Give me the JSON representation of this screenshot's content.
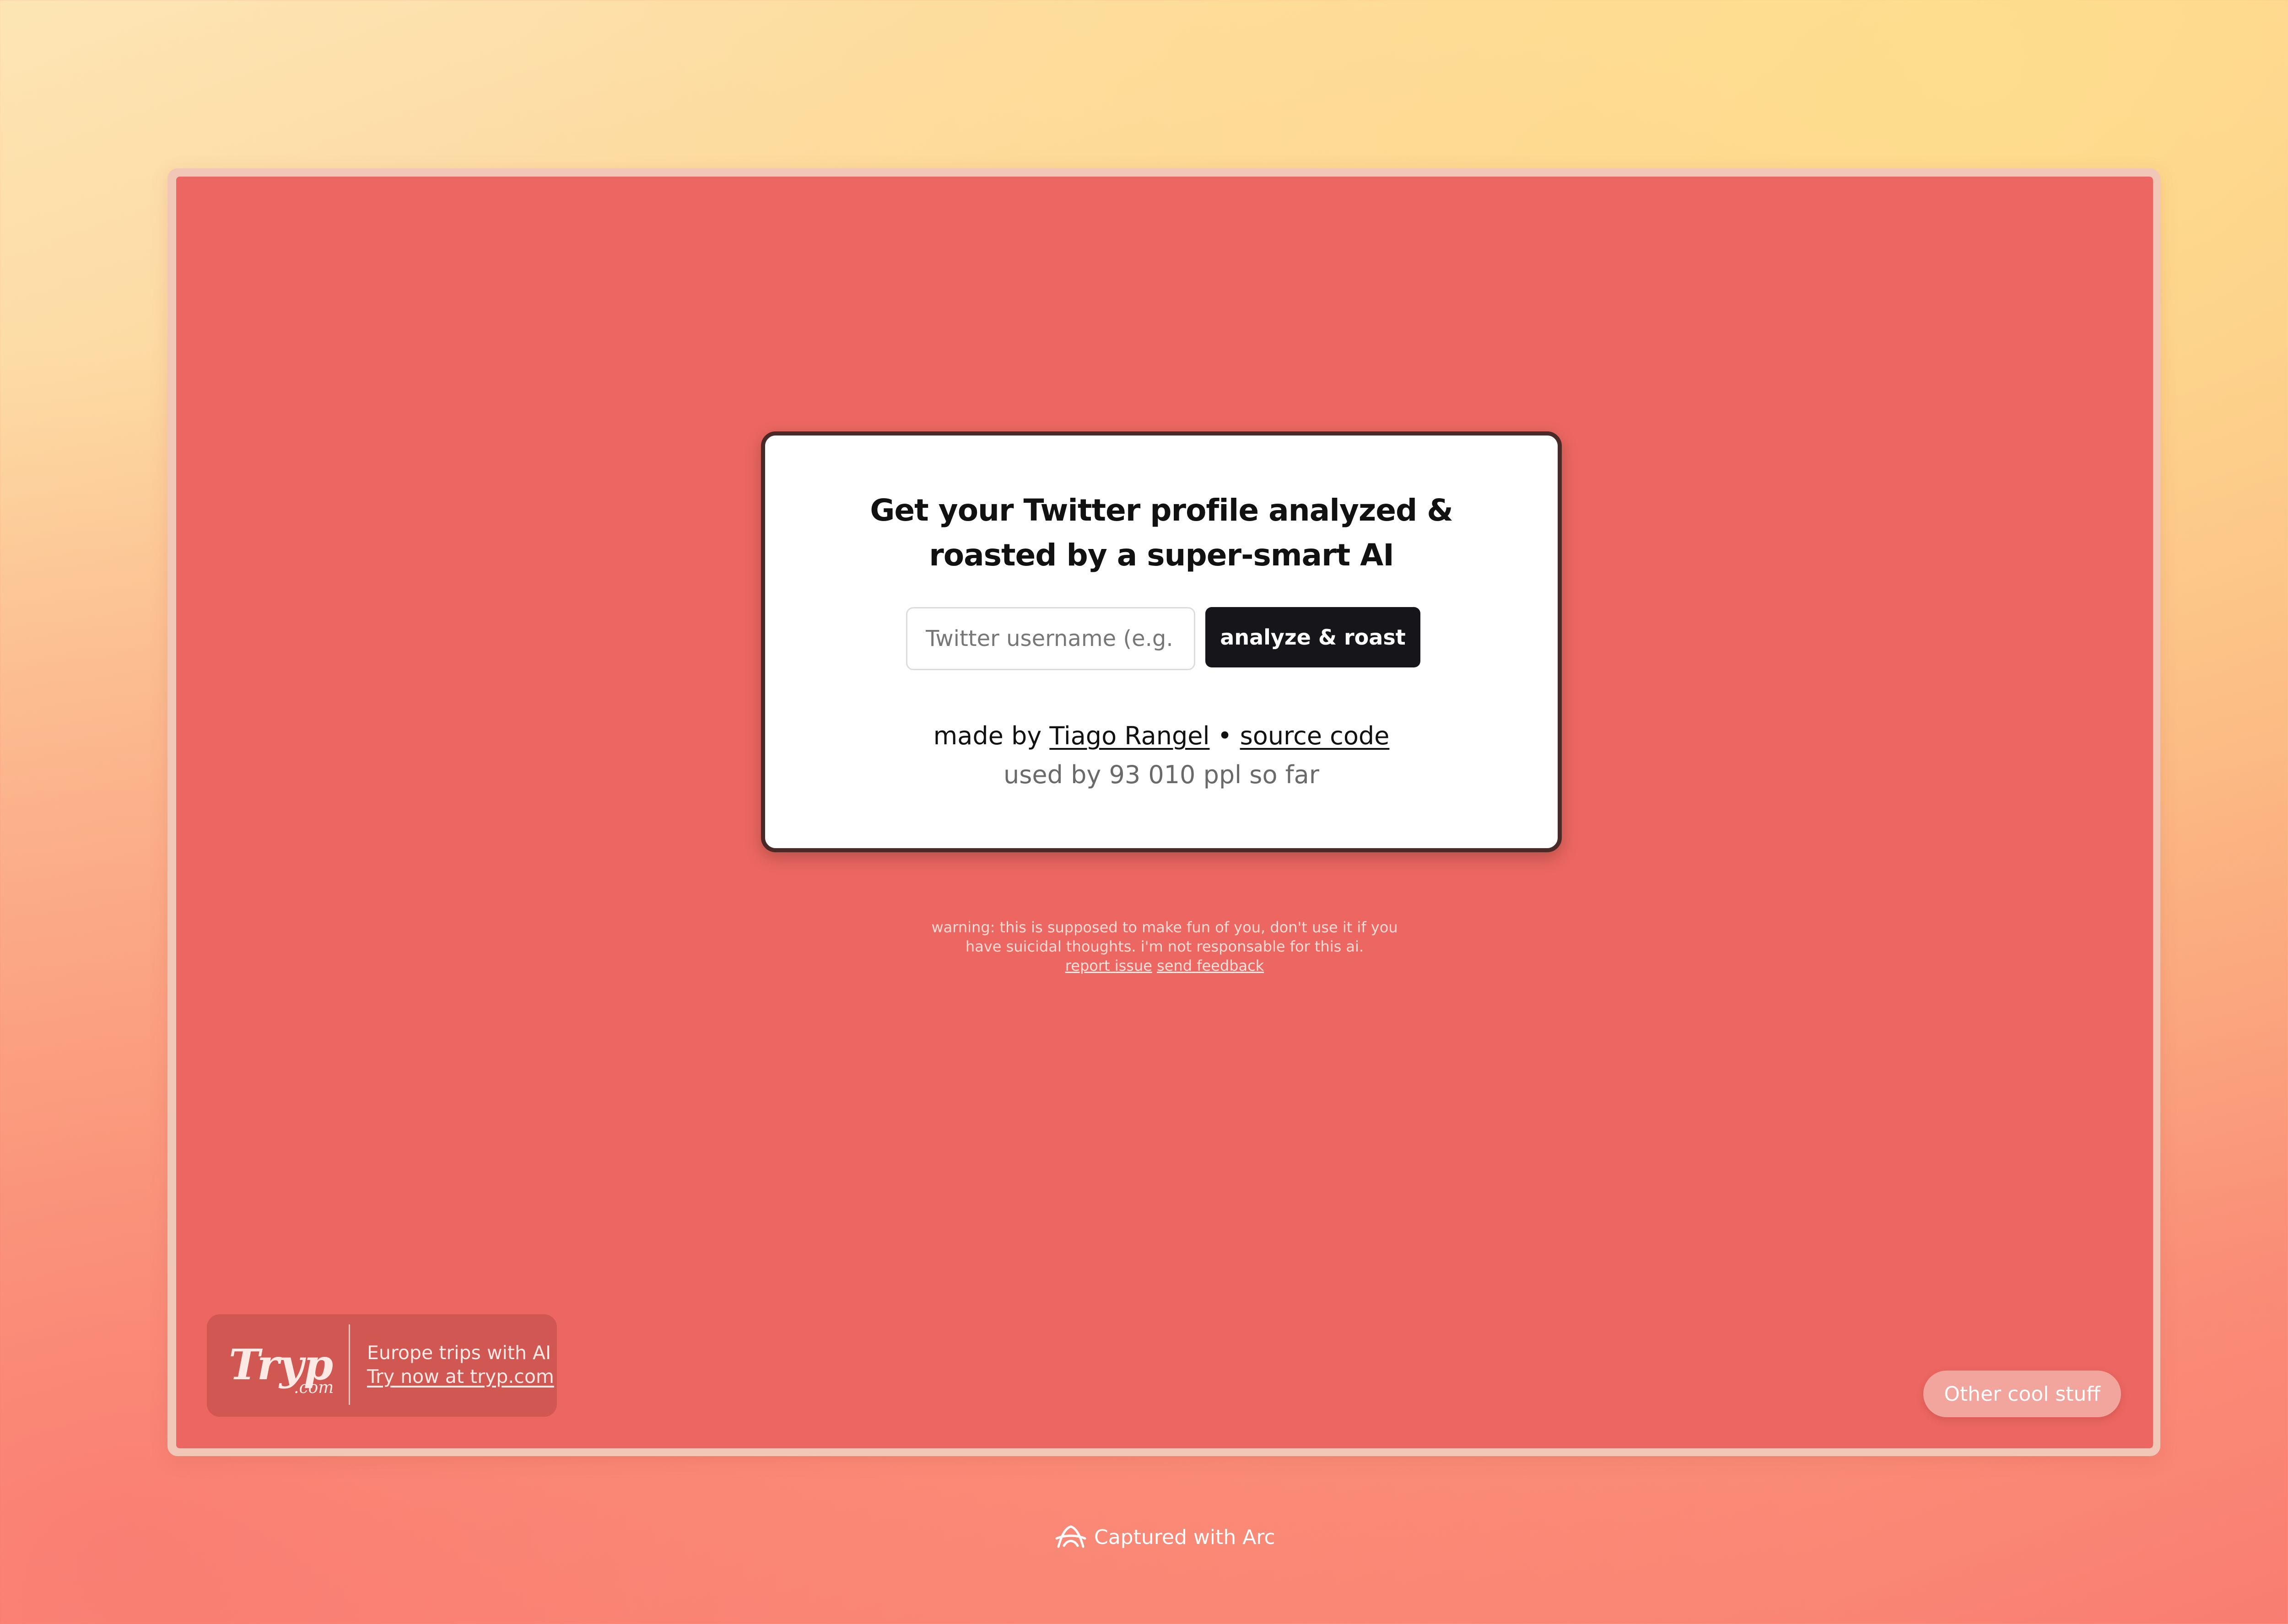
{
  "card": {
    "title_line1": "Get your Twitter profile analyzed &",
    "title_line2": "roasted by a super-smart AI",
    "input_placeholder": "Twitter username (e.g. @elonmusk)",
    "submit_label": "analyze & roast",
    "made_by_prefix": "made by",
    "author_link": "Tiago Rangel",
    "separator": "•",
    "source_link": "source code",
    "usage_text": "used by 93 010 ppl so far"
  },
  "warning": {
    "line1": "warning: this is supposed to make fun of you, don't use it if you",
    "line2": "have suicidal thoughts. i'm not responsable for this ai.",
    "report_link": "report issue",
    "feedback_link": "send feedback"
  },
  "tryp_ad": {
    "logo_main": "Tryp",
    "logo_suffix": ".com",
    "tagline": "Europe trips with AI",
    "cta": "Try now at tryp.com"
  },
  "cool_button": "Other cool stuff",
  "footer": {
    "capture_text": "Captured with Arc",
    "icon": "arc-icon"
  },
  "colors": {
    "page_accent": "#ec6762",
    "button_dark": "#16161a",
    "card_border": "#4a2a26"
  }
}
